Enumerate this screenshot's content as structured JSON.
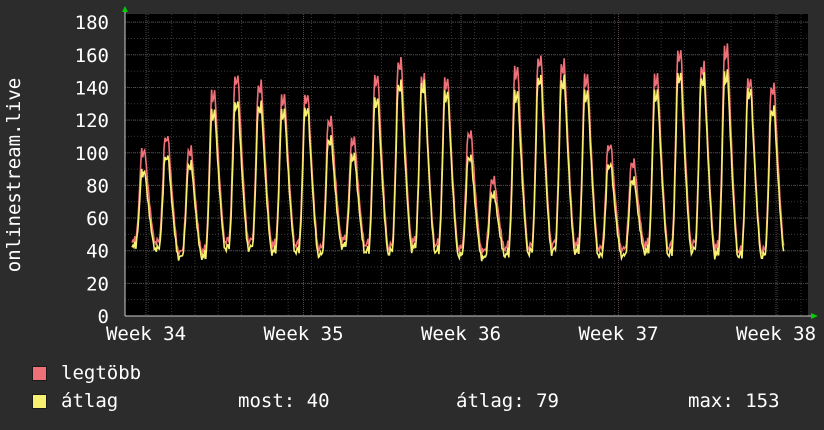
{
  "chart_data": {
    "type": "line",
    "ylabel": "onlinestream.live",
    "ylim": [
      0,
      185
    ],
    "yticks": [
      0,
      20,
      40,
      60,
      80,
      100,
      120,
      140,
      160,
      180
    ],
    "xticks": [
      "Week 34",
      "Week 35",
      "Week 36",
      "Week 37",
      "Week 38"
    ],
    "grid": true,
    "day_peaks_legtobb": [
      103,
      112,
      104,
      140,
      150,
      145,
      137,
      138,
      123,
      110,
      150,
      160,
      149,
      148,
      115,
      85,
      155,
      162,
      158,
      150,
      107,
      96,
      150,
      166,
      157,
      168,
      148,
      144
    ],
    "day_troughs_legtobb": [
      45,
      44,
      38,
      38,
      44,
      44,
      42,
      42,
      40,
      46,
      42,
      40,
      44,
      42,
      40,
      39,
      40,
      40,
      42,
      42,
      40,
      40,
      42,
      40,
      42,
      40,
      38,
      38
    ],
    "day_peaks_atlag": [
      90,
      100,
      95,
      128,
      134,
      132,
      128,
      130,
      111,
      100,
      136,
      146,
      145,
      140,
      100,
      76,
      140,
      150,
      148,
      140,
      95,
      85,
      140,
      152,
      150,
      152,
      142,
      130
    ],
    "day_troughs_atlag": [
      42,
      40,
      35,
      35,
      40,
      40,
      38,
      38,
      36,
      42,
      38,
      37,
      40,
      38,
      36,
      35,
      36,
      37,
      38,
      38,
      36,
      36,
      38,
      36,
      38,
      36,
      35,
      35
    ],
    "series": [
      {
        "name": "legtöbb",
        "color": "#f07078"
      },
      {
        "name": "átlag",
        "color": "#f8f070"
      }
    ]
  },
  "legend": {
    "legtobb_label": "legtöbb",
    "atlag_label": "átlag",
    "legtobb_color": "#f07078",
    "atlag_color": "#f8f070"
  },
  "stats": {
    "most": "most: 40",
    "atlag": "átlag: 79",
    "max": "max: 153"
  }
}
